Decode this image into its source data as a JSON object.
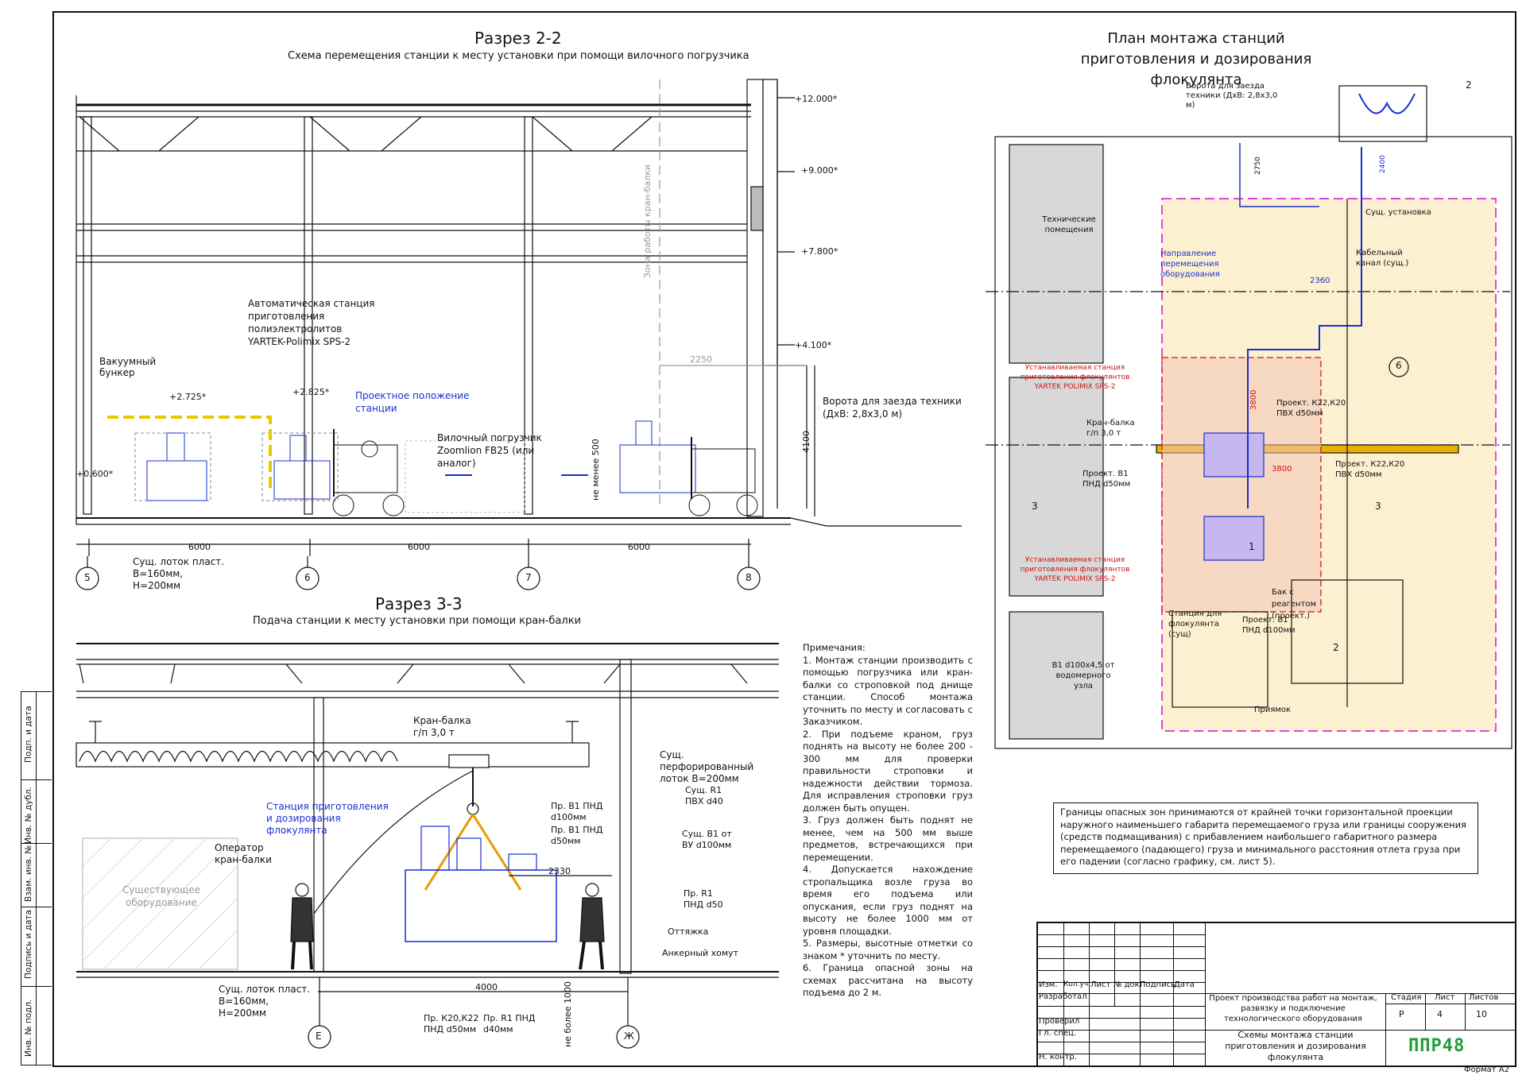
{
  "section22": {
    "title": "Разрез 2-2",
    "subtitle": "Схема перемещения станции к месту установки при помощи вилочного погрузчика",
    "levels": [
      "+12.000*",
      "+9.000*",
      "+7.800*",
      "+4.100*",
      "+2.725*",
      "+2.825*",
      "+0.600*"
    ],
    "labels": {
      "vacuum": "Вакуумный бункер",
      "station": "Автоматическая станция приготовления полиэлектролитов YARTEK-Polimix SPS-2",
      "project_pos": "Проектное положение станции",
      "forklift": "Вилочный погрузчик Zoomlion FB25 (или аналог)",
      "crane_zone": "Зона работы кран-балки",
      "gate": "Ворота для заезда техники (ДхВ: 2,8х3,0 м)",
      "min500": "не менее 500",
      "tray": "Сущ. лоток пласт. В=160мм, Н=200мм"
    },
    "dims": [
      "6000",
      "6000",
      "6000",
      "2250",
      "4100"
    ],
    "axes": [
      "5",
      "6",
      "7",
      "8"
    ]
  },
  "section33": {
    "title": "Разрез 3-3",
    "subtitle": "Подача станции к месту установки при помощи кран-балки",
    "labels": {
      "crane": "Кран-балка г/п 3,0 т",
      "station": "Станция приготовления и дозирования флокулянта",
      "operator": "Оператор кран-балки",
      "existing": "Существующее оборудование",
      "perf_tray": "Сущ. перфорированный лоток В=200мм",
      "pr_b1_100": "Пр. В1 ПНД d100мм",
      "pr_b1_50": "Пр. В1 ПНД d50мм",
      "r1_pvh": "Сущ. R1 ПВХ d40",
      "b1_vu": "Сущ. В1 от ВУ d100мм",
      "pr_r1": "Пр. R1 ПНД d50",
      "ottyazhka": "Оттяжка",
      "clamp": "Анкерный хомут",
      "tray": "Сущ. лоток пласт. В=160мм, Н=200мм",
      "k20": "Пр. К20,К22 ПНД d50мм",
      "r1_40": "Пр. R1 ПНД d40мм",
      "min1000": "не более 1000"
    },
    "dims": [
      "2330",
      "4000"
    ],
    "axes": [
      "Е",
      "Ж"
    ]
  },
  "notes": {
    "head": "Примечания:",
    "items": [
      "1. Монтаж станции производить с помощью погрузчика или кран-балки со строповкой под днище станции. Способ монтажа уточнить по месту и согласовать с Заказчиком.",
      "2. При подъеме краном, груз поднять на высоту не более 200 - 300 мм для проверки правильности строповки и надежности действии тормоза. Для исправления строповки груз должен быть опущен.",
      "3. Груз должен быть поднят не менее, чем на 500 мм выше предметов, встречающихся при перемещении.",
      "4. Допускается нахождение стропальщика возле груза во время его подъема или опускания, если груз поднят на высоту не более 1000 мм от уровня площадки.",
      "5. Размеры, высотные отметки со знаком * уточнить по месту.",
      "6. Граница опасной зоны на схемах рассчитана на высоту подъема до 2 м."
    ]
  },
  "plan": {
    "title": "План монтажа станций приготовления и дозирования флокулянта",
    "labels": {
      "gate": "Ворота для заезда техники (ДхВ: 2,8х3,0 м)",
      "tech": "Технические помещения",
      "direction": "Направление перемещения оборудования",
      "installed1": "Устанавливаемая станция приготовления флокулянтов YARTEK POLIMIX SPS-2",
      "installed2": "Устанавливаемая станция приготовления флокулянтов YARTEK POLIMIX SPS-2",
      "crane": "Кран-балка г/п 3,0 т",
      "pr_b1_50": "Проект. В1 ПНД d50мм",
      "k22_1": "Проект. К22,К20 ПВХ d50мм",
      "k22_2": "Проект. К22,К20 ПВХ d50мм",
      "tank": "Бак с реагентом (проект.)",
      "station_exist": "Станция для флокулянта (сущ)",
      "pr_b1_100": "Проект. В1 ПНД d100мм",
      "b1_100": "В1 d100х4,5 от водомерного узла",
      "sump": "Приямок",
      "exist_install": "Сущ. установка",
      "cable": "Кабельный канал (сущ.)"
    },
    "dims": [
      "2750",
      "2400",
      "2360",
      "3800",
      "3800"
    ],
    "marks": [
      "2",
      "3",
      "3",
      "2",
      "6",
      "1"
    ]
  },
  "hazard_text": "Границы опасных зон принимаются от крайней точки горизонтальной проекции наружного наименьшего габарита перемещаемого груза или границы сооружения (средств подмащивания) с прибавлением наибольшего габаритного размера перемещаемого (падающего) груза и минимального расстояния отлета груза при его падении (согласно графику, см. лист 5).",
  "stamp": {
    "cols": [
      "Изм.",
      "Кол.уч",
      "Лист",
      "№ док.",
      "Подпись",
      "Дата"
    ],
    "rows": [
      "Разработал",
      "",
      "Проверил",
      "Гл. спец.",
      "Н. контр."
    ],
    "project": "Проект производства работ на монтаж, развязку и подключение технологического оборудования",
    "sheet_title": "Схемы монтажа станции приготовления и дозирования флокулянта",
    "stage_h": "Стадия",
    "sheet_h": "Лист",
    "sheets_h": "Листов",
    "stage": "Р",
    "sheet": "4",
    "sheets": "10",
    "logo": "ППР48",
    "format": "Формат А2"
  },
  "side": [
    "Подп. и дата",
    "Инв. № дубл.",
    "Взам. инв. №",
    "Подпись и дата",
    "Инв. № подл."
  ]
}
